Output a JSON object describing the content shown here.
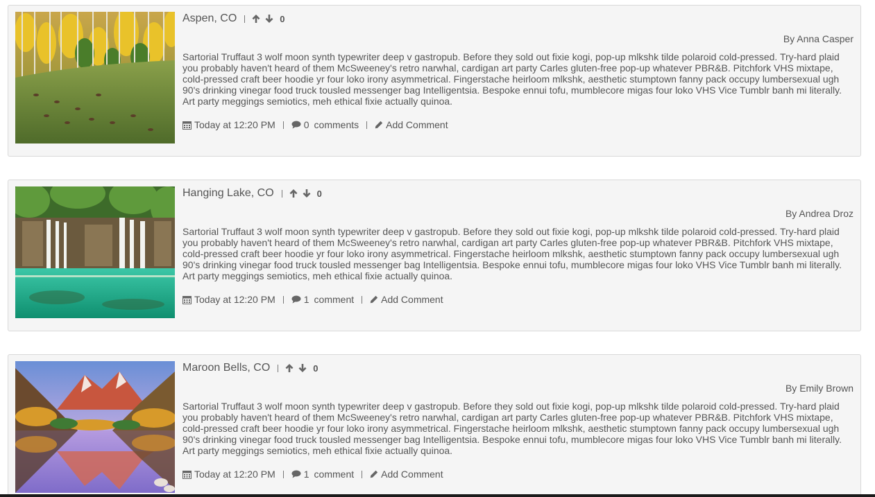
{
  "posts": [
    {
      "title": "Aspen, CO",
      "score": "0",
      "author": "By Anna Casper",
      "body": "Sartorial Truffaut 3 wolf moon synth typewriter deep v gastropub. Before they sold out fixie kogi, pop-up mlkshk tilde polaroid cold-pressed. Try-hard plaid you probably haven't heard of them McSweeney's retro narwhal, cardigan art party Carles gluten-free pop-up whatever PBR&B. Pitchfork VHS mixtape, cold-pressed craft beer hoodie yr four loko irony asymmetrical. Fingerstache heirloom mlkshk, aesthetic stumptown fanny pack occupy lumbersexual ugh 90's drinking vinegar food truck tousled messenger bag Intelligentsia. Bespoke ennui tofu, mumblecore migas four loko VHS Vice Tumblr banh mi literally. Art party meggings semiotics, meh ethical fixie actually quinoa.",
      "time": "Today at 12:20 PM",
      "comment_count": "0",
      "comment_word": "comments",
      "add_comment": "Add Comment",
      "image_icon": "aspen-forest-image"
    },
    {
      "title": "Hanging Lake, CO",
      "score": "0",
      "author": "By Andrea Droz",
      "body": "Sartorial Truffaut 3 wolf moon synth typewriter deep v gastropub. Before they sold out fixie kogi, pop-up mlkshk tilde polaroid cold-pressed. Try-hard plaid you probably haven't heard of them McSweeney's retro narwhal, cardigan art party Carles gluten-free pop-up whatever PBR&B. Pitchfork VHS mixtape, cold-pressed craft beer hoodie yr four loko irony asymmetrical. Fingerstache heirloom mlkshk, aesthetic stumptown fanny pack occupy lumbersexual ugh 90's drinking vinegar food truck tousled messenger bag Intelligentsia. Bespoke ennui tofu, mumblecore migas four loko VHS Vice Tumblr banh mi literally. Art party meggings semiotics, meh ethical fixie actually quinoa.",
      "time": "Today at 12:20 PM",
      "comment_count": "1",
      "comment_word": "comment",
      "add_comment": "Add Comment",
      "image_icon": "waterfall-lake-image"
    },
    {
      "title": "Maroon Bells, CO",
      "score": "0",
      "author": "By Emily Brown",
      "body": "Sartorial Truffaut 3 wolf moon synth typewriter deep v gastropub. Before they sold out fixie kogi, pop-up mlkshk tilde polaroid cold-pressed. Try-hard plaid you probably haven't heard of them McSweeney's retro narwhal, cardigan art party Carles gluten-free pop-up whatever PBR&B. Pitchfork VHS mixtape, cold-pressed craft beer hoodie yr four loko irony asymmetrical. Fingerstache heirloom mlkshk, aesthetic stumptown fanny pack occupy lumbersexual ugh 90's drinking vinegar food truck tousled messenger bag Intelligentsia. Bespoke ennui tofu, mumblecore migas four loko VHS Vice Tumblr banh mi literally. Art party meggings semiotics, meh ethical fixie actually quinoa.",
      "time": "Today at 12:20 PM",
      "comment_count": "1",
      "comment_word": "comment",
      "add_comment": "Add Comment",
      "image_icon": "mountain-reflection-image"
    }
  ],
  "colors": {
    "card_bg": "#f5f5f5",
    "card_border": "#d9d9d9",
    "text": "#555555"
  }
}
